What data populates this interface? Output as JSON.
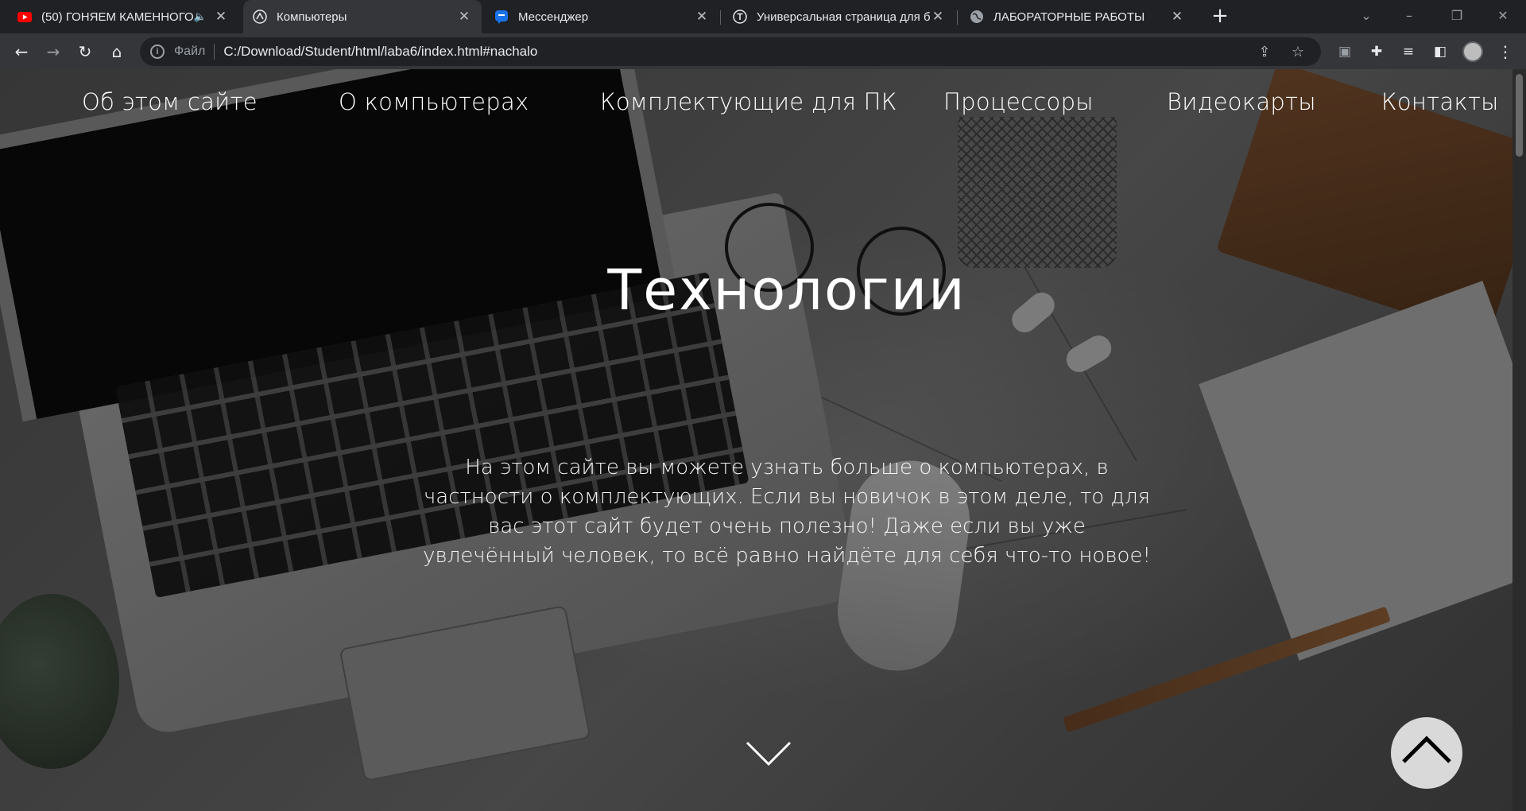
{
  "browser": {
    "tabs": [
      {
        "label": "(50) ГОНЯЕМ КАМЕННОГО",
        "icon": "youtube-icon",
        "audio": "🔈",
        "active": false
      },
      {
        "label": "Компьютеры",
        "icon": "page-favicon-icon",
        "active": true
      },
      {
        "label": "Мессенджер",
        "icon": "messenger-icon",
        "active": false
      },
      {
        "label": "Универсальная страница для би",
        "icon": "t-circle-icon",
        "active": false
      },
      {
        "label": "ЛАБОРАТОРНЫЕ РАБОТЫ",
        "icon": "globe-icon",
        "active": false
      }
    ],
    "new_tab": "+",
    "address": {
      "scheme_label": "Файл",
      "url": "C:/Download/Student/html/laba6/index.html#nachalo"
    }
  },
  "site": {
    "nav": [
      "Об этом сайте",
      "О компьютерах",
      "Комплектующие для ПК",
      "Процессоры",
      "Видеокарты",
      "Контакты"
    ],
    "hero_title": "Технологии",
    "hero_text": "На этом сайте вы можете узнать больше о компьютерах, в частности о комплектующих. Если вы новичок в этом деле, то для вас этот сайт будет очень полезно! Даже если вы уже увлечённый человек, то всё равно найдёте для себя что-то новое!"
  },
  "colors": {
    "chrome_dark": "#202124",
    "chrome_toolbar": "#35363a",
    "youtube_red": "#ff0000",
    "messenger_blue": "#1a73e8",
    "hero_text": "#ffffff"
  }
}
